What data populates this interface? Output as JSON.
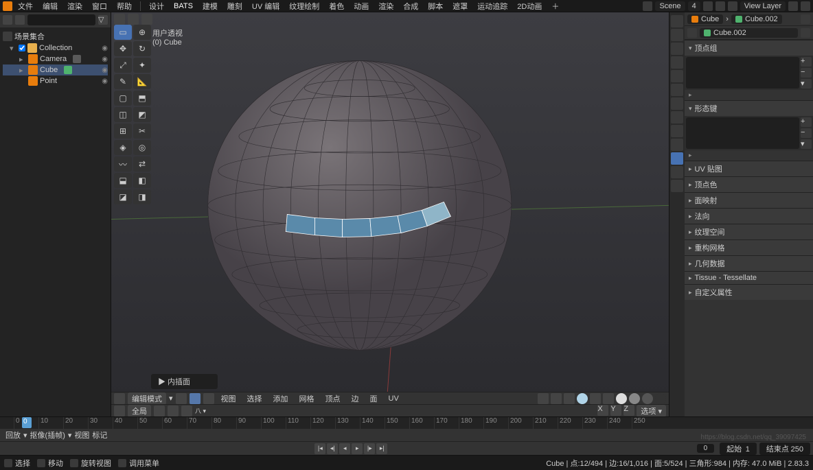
{
  "topmenu": {
    "file": "文件",
    "edit": "编辑",
    "render": "渲染",
    "window": "窗口",
    "help": "帮助"
  },
  "workspaces": [
    "设计",
    "BATS",
    "建模",
    "雕刻",
    "UV 编辑",
    "纹理绘制",
    "着色",
    "动画",
    "渲染",
    "合成",
    "脚本",
    "遮罩",
    "运动追踪",
    "2D动画",
    "＋"
  ],
  "scene_label": "Scene",
  "scene_count": "4",
  "viewlayer_label": "View Layer",
  "outliner": {
    "scene": "场景集合",
    "collection": "Collection",
    "camera": "Camera",
    "cube": "Cube",
    "point": "Point"
  },
  "viewport": {
    "persp": "用户透视",
    "obj": "(0) Cube"
  },
  "vp_menu": {
    "mode": "编辑模式",
    "view": "视图",
    "select": "选择",
    "add": "添加",
    "mesh": "网格",
    "vertex": "顶点",
    "edge": "边",
    "face": "面",
    "uv": "UV",
    "overlay": "全局"
  },
  "floating": "▶ 内插面",
  "props": {
    "crumb_obj": "Cube",
    "crumb_data": "Cube.002",
    "crumb2": "Cube.002",
    "panels": [
      "顶点组",
      "形态键",
      "UV 贴图",
      "顶点色",
      "面映射",
      "法向",
      "纹理空间",
      "重构网格",
      "几何数据",
      "Tissue - Tessellate",
      "自定义属性"
    ]
  },
  "timeline": {
    "playback": "回放",
    "keying": "抠像(插帧)",
    "view": "视图",
    "marker": "标记",
    "frames": [
      "0",
      "10",
      "20",
      "30",
      "40",
      "50",
      "60",
      "70",
      "80",
      "90",
      "100",
      "110",
      "120",
      "130",
      "140",
      "150",
      "160",
      "170",
      "180",
      "190",
      "200",
      "210",
      "220",
      "230",
      "240",
      "250"
    ],
    "cur": "0",
    "start_lbl": "起始",
    "start": "1",
    "end_lbl": "结束点",
    "end": "250"
  },
  "status": {
    "select": "选择",
    "move": "移动",
    "rotate": "旋转视图",
    "menu": "调用菜单",
    "stats": "Cube | 点:12/494 | 边:16/1,016 | 面:5/524 | 三角形:984 | 内存: 47.0 MiB | 2.83.3"
  },
  "watermark": "https://blog.csdn.net/qq_39097425"
}
